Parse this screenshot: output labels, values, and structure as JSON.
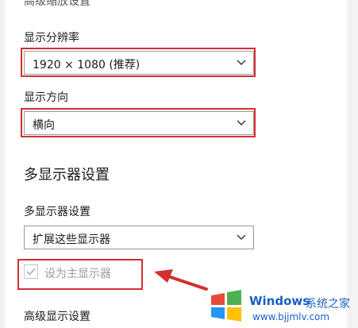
{
  "settings": {
    "clipped_title": "高级缩放设置",
    "resolution": {
      "label": "显示分辨率",
      "value": "1920 × 1080 (推荐)"
    },
    "orientation": {
      "label": "显示方向",
      "value": "横向"
    },
    "multi_display": {
      "heading": "多显示器设置",
      "label": "多显示器设置",
      "value": "扩展这些显示器",
      "primary_checkbox_label": "设为主显示器",
      "primary_checked": true
    },
    "advanced_link": "高级显示设置"
  },
  "watermark": {
    "brand": "Windows",
    "brand_cn": "系统之家",
    "site": "www.bjjmlv.com"
  },
  "colors": {
    "highlight": "#d32f2f",
    "brand": "#1a5fc4"
  },
  "icons": [
    "chevron-down-icon",
    "checkmark-icon",
    "red-arrow-icon",
    "windows-logo-icon"
  ]
}
